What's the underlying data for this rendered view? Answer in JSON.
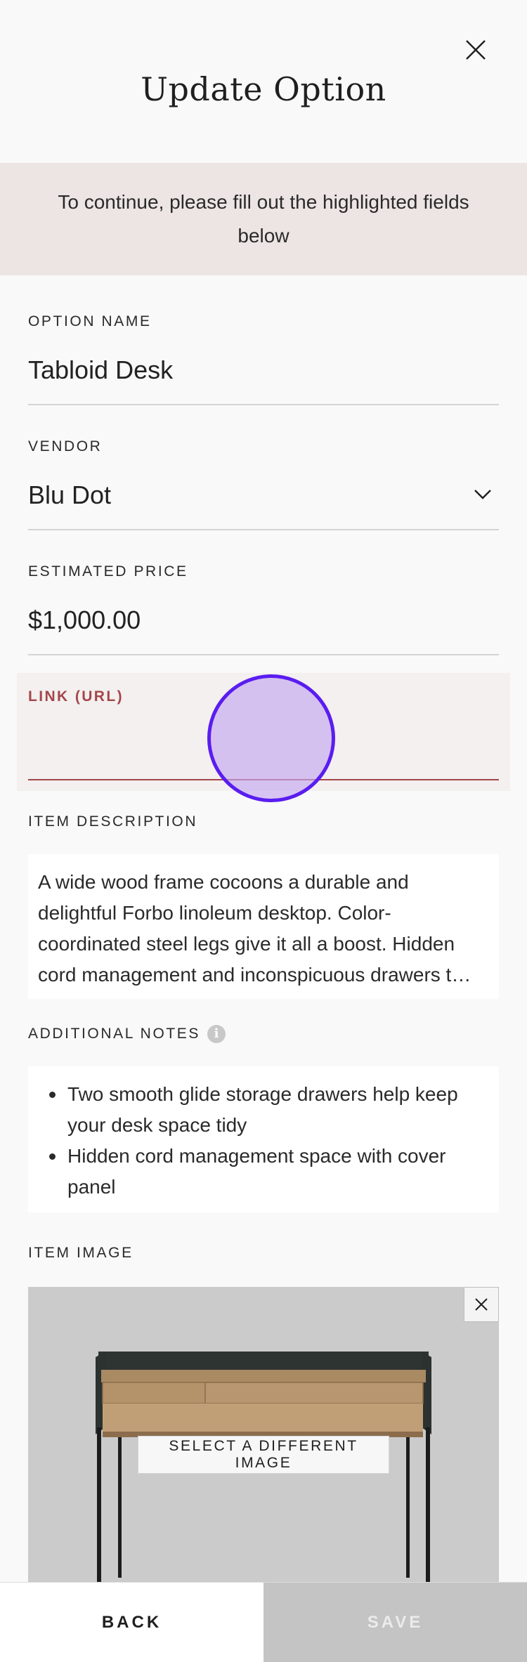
{
  "modal": {
    "title": "Update Option",
    "close_icon": "close-icon"
  },
  "banner": {
    "message": "To continue, please fill out the highlighted fields below"
  },
  "fields": {
    "option_name": {
      "label": "OPTION NAME",
      "value": "Tabloid Desk"
    },
    "vendor": {
      "label": "VENDOR",
      "value": "Blu Dot",
      "icon": "chevron-down-icon"
    },
    "estimated_price": {
      "label": "ESTIMATED PRICE",
      "value": "$1,000.00"
    },
    "link": {
      "label": "LINK (URL)",
      "value": ""
    },
    "item_description": {
      "label": "ITEM DESCRIPTION",
      "value": "A wide wood frame cocoons a durable and delightful Forbo linoleum desktop. Color-coordinated steel legs give it all a boost. Hidden cord management and inconspicuous drawers t…"
    },
    "additional_notes": {
      "label": "ADDITIONAL NOTES",
      "icon": "info-icon",
      "items": [
        "Two smooth glide storage drawers help keep your desk space tidy",
        "Hidden cord management space with cover panel"
      ]
    },
    "item_image": {
      "label": "ITEM IMAGE",
      "select_button": "SELECT A DIFFERENT IMAGE",
      "remove_icon": "close-icon"
    }
  },
  "footer": {
    "back_label": "BACK",
    "save_label": "SAVE"
  },
  "colors": {
    "error": "#a4464b",
    "banner_bg": "#ede5e3",
    "touch_indicator": "#5a1df0",
    "save_disabled_bg": "#c4c4c4"
  }
}
